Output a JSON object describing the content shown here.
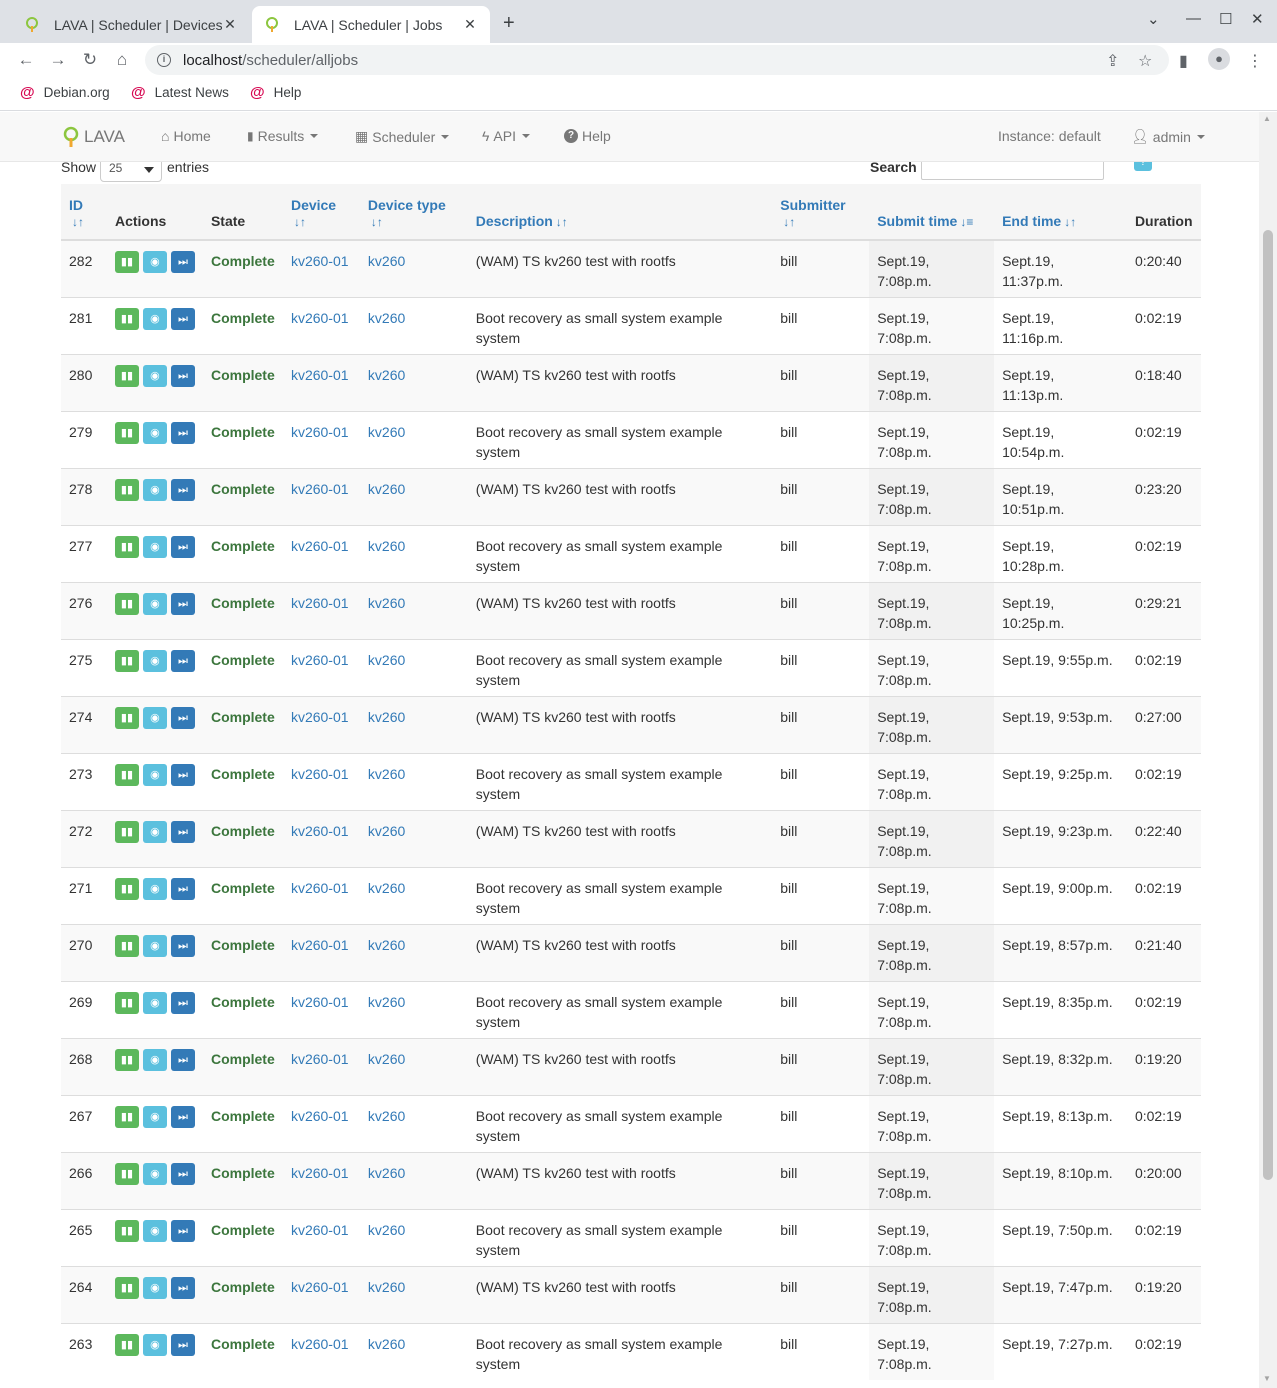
{
  "browser": {
    "tabs": [
      {
        "title": "LAVA | Scheduler | Devices",
        "active": false
      },
      {
        "title": "LAVA | Scheduler | Jobs",
        "active": true
      }
    ],
    "url_host": "localhost",
    "url_path": "/scheduler/alljobs",
    "bookmarks": [
      "Debian.org",
      "Latest News",
      "Help"
    ]
  },
  "navbar": {
    "brand": "LAVA",
    "home": "Home",
    "results": "Results",
    "scheduler": "Scheduler",
    "api": "API",
    "help": "Help",
    "instance": "Instance: default",
    "user": "admin"
  },
  "controls": {
    "show_label": "Show",
    "page_size": "25",
    "entries_label": "entries",
    "search_label": "Search",
    "help_icon": "?"
  },
  "columns": [
    "ID",
    "Actions",
    "State",
    "Device",
    "Device type",
    "Description",
    "Submitter",
    "Submit time",
    "End time",
    "Duration"
  ],
  "rows": [
    {
      "id": "282",
      "state": "Complete",
      "device": "kv260-01",
      "device_type": "kv260",
      "description": "(WAM) TS kv260 test with rootfs",
      "submitter": "bill",
      "submit_time": "Sept.19, 7:08p.m.",
      "end_time": "Sept.19, 11:37p.m.",
      "duration": "0:20:40"
    },
    {
      "id": "281",
      "state": "Complete",
      "device": "kv260-01",
      "device_type": "kv260",
      "description": "Boot recovery as small system example system",
      "submitter": "bill",
      "submit_time": "Sept.19, 7:08p.m.",
      "end_time": "Sept.19, 11:16p.m.",
      "duration": "0:02:19"
    },
    {
      "id": "280",
      "state": "Complete",
      "device": "kv260-01",
      "device_type": "kv260",
      "description": "(WAM) TS kv260 test with rootfs",
      "submitter": "bill",
      "submit_time": "Sept.19, 7:08p.m.",
      "end_time": "Sept.19, 11:13p.m.",
      "duration": "0:18:40"
    },
    {
      "id": "279",
      "state": "Complete",
      "device": "kv260-01",
      "device_type": "kv260",
      "description": "Boot recovery as small system example system",
      "submitter": "bill",
      "submit_time": "Sept.19, 7:08p.m.",
      "end_time": "Sept.19, 10:54p.m.",
      "duration": "0:02:19"
    },
    {
      "id": "278",
      "state": "Complete",
      "device": "kv260-01",
      "device_type": "kv260",
      "description": "(WAM) TS kv260 test with rootfs",
      "submitter": "bill",
      "submit_time": "Sept.19, 7:08p.m.",
      "end_time": "Sept.19, 10:51p.m.",
      "duration": "0:23:20"
    },
    {
      "id": "277",
      "state": "Complete",
      "device": "kv260-01",
      "device_type": "kv260",
      "description": "Boot recovery as small system example system",
      "submitter": "bill",
      "submit_time": "Sept.19, 7:08p.m.",
      "end_time": "Sept.19, 10:28p.m.",
      "duration": "0:02:19"
    },
    {
      "id": "276",
      "state": "Complete",
      "device": "kv260-01",
      "device_type": "kv260",
      "description": "(WAM) TS kv260 test with rootfs",
      "submitter": "bill",
      "submit_time": "Sept.19, 7:08p.m.",
      "end_time": "Sept.19, 10:25p.m.",
      "duration": "0:29:21"
    },
    {
      "id": "275",
      "state": "Complete",
      "device": "kv260-01",
      "device_type": "kv260",
      "description": "Boot recovery as small system example system",
      "submitter": "bill",
      "submit_time": "Sept.19, 7:08p.m.",
      "end_time": "Sept.19, 9:55p.m.",
      "duration": "0:02:19"
    },
    {
      "id": "274",
      "state": "Complete",
      "device": "kv260-01",
      "device_type": "kv260",
      "description": "(WAM) TS kv260 test with rootfs",
      "submitter": "bill",
      "submit_time": "Sept.19, 7:08p.m.",
      "end_time": "Sept.19, 9:53p.m.",
      "duration": "0:27:00"
    },
    {
      "id": "273",
      "state": "Complete",
      "device": "kv260-01",
      "device_type": "kv260",
      "description": "Boot recovery as small system example system",
      "submitter": "bill",
      "submit_time": "Sept.19, 7:08p.m.",
      "end_time": "Sept.19, 9:25p.m.",
      "duration": "0:02:19"
    },
    {
      "id": "272",
      "state": "Complete",
      "device": "kv260-01",
      "device_type": "kv260",
      "description": "(WAM) TS kv260 test with rootfs",
      "submitter": "bill",
      "submit_time": "Sept.19, 7:08p.m.",
      "end_time": "Sept.19, 9:23p.m.",
      "duration": "0:22:40"
    },
    {
      "id": "271",
      "state": "Complete",
      "device": "kv260-01",
      "device_type": "kv260",
      "description": "Boot recovery as small system example system",
      "submitter": "bill",
      "submit_time": "Sept.19, 7:08p.m.",
      "end_time": "Sept.19, 9:00p.m.",
      "duration": "0:02:19"
    },
    {
      "id": "270",
      "state": "Complete",
      "device": "kv260-01",
      "device_type": "kv260",
      "description": "(WAM) TS kv260 test with rootfs",
      "submitter": "bill",
      "submit_time": "Sept.19, 7:08p.m.",
      "end_time": "Sept.19, 8:57p.m.",
      "duration": "0:21:40"
    },
    {
      "id": "269",
      "state": "Complete",
      "device": "kv260-01",
      "device_type": "kv260",
      "description": "Boot recovery as small system example system",
      "submitter": "bill",
      "submit_time": "Sept.19, 7:08p.m.",
      "end_time": "Sept.19, 8:35p.m.",
      "duration": "0:02:19"
    },
    {
      "id": "268",
      "state": "Complete",
      "device": "kv260-01",
      "device_type": "kv260",
      "description": "(WAM) TS kv260 test with rootfs",
      "submitter": "bill",
      "submit_time": "Sept.19, 7:08p.m.",
      "end_time": "Sept.19, 8:32p.m.",
      "duration": "0:19:20"
    },
    {
      "id": "267",
      "state": "Complete",
      "device": "kv260-01",
      "device_type": "kv260",
      "description": "Boot recovery as small system example system",
      "submitter": "bill",
      "submit_time": "Sept.19, 7:08p.m.",
      "end_time": "Sept.19, 8:13p.m.",
      "duration": "0:02:19"
    },
    {
      "id": "266",
      "state": "Complete",
      "device": "kv260-01",
      "device_type": "kv260",
      "description": "(WAM) TS kv260 test with rootfs",
      "submitter": "bill",
      "submit_time": "Sept.19, 7:08p.m.",
      "end_time": "Sept.19, 8:10p.m.",
      "duration": "0:20:00"
    },
    {
      "id": "265",
      "state": "Complete",
      "device": "kv260-01",
      "device_type": "kv260",
      "description": "Boot recovery as small system example system",
      "submitter": "bill",
      "submit_time": "Sept.19, 7:08p.m.",
      "end_time": "Sept.19, 7:50p.m.",
      "duration": "0:02:19"
    },
    {
      "id": "264",
      "state": "Complete",
      "device": "kv260-01",
      "device_type": "kv260",
      "description": "(WAM) TS kv260 test with rootfs",
      "submitter": "bill",
      "submit_time": "Sept.19, 7:08p.m.",
      "end_time": "Sept.19, 7:47p.m.",
      "duration": "0:19:20"
    },
    {
      "id": "263",
      "state": "Complete",
      "device": "kv260-01",
      "device_type": "kv260",
      "description": "Boot recovery as small system example system",
      "submitter": "bill",
      "submit_time": "Sept.19, 7:08p.m.",
      "end_time": "Sept.19, 7:27p.m.",
      "duration": "0:02:19"
    }
  ],
  "colors": {
    "state_complete": "#3c763d",
    "link": "#337ab7",
    "btn_results": "#5cb85c",
    "btn_view": "#5bc0de",
    "btn_skip": "#337ab7"
  }
}
